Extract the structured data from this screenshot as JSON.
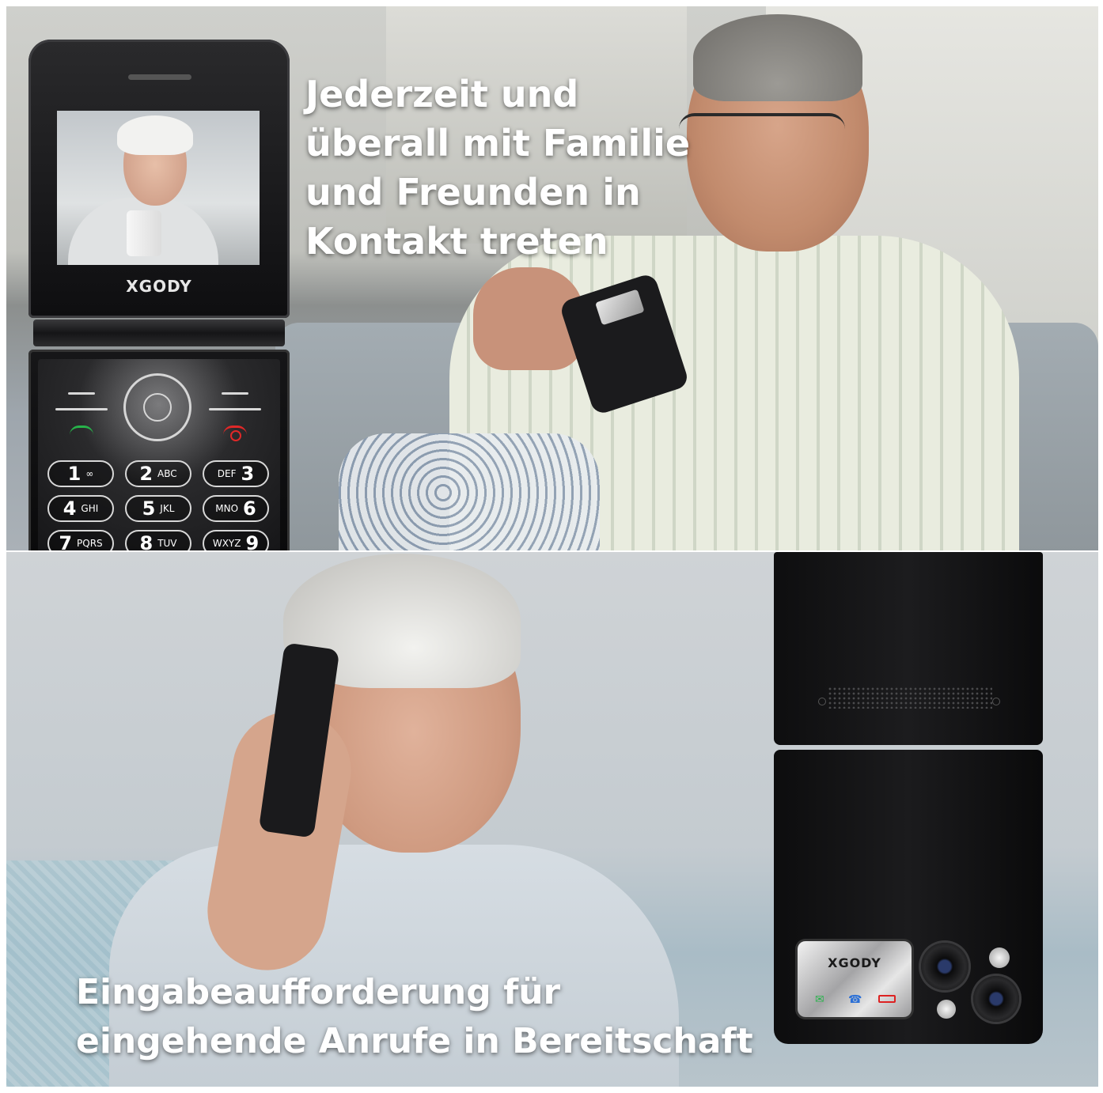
{
  "headlines": {
    "top": {
      "lines": [
        "Jederzeit und",
        "überall mit Familie",
        "und Freunden in",
        "Kontakt treten"
      ]
    },
    "bottom": {
      "lines": [
        "Eingabeaufforderung für",
        "eingehende Anrufe in Bereitschaft"
      ]
    }
  },
  "phone": {
    "brand": "XGODY",
    "keypad": [
      {
        "digit": "1",
        "letters": "∞"
      },
      {
        "digit": "2",
        "letters": "ABC"
      },
      {
        "digit": "3",
        "letters": "DEF"
      },
      {
        "digit": "4",
        "letters": "GHI"
      },
      {
        "digit": "5",
        "letters": "JKL"
      },
      {
        "digit": "6",
        "letters": "MNO"
      },
      {
        "digit": "7",
        "letters": "PQRS"
      },
      {
        "digit": "8",
        "letters": "TUV"
      },
      {
        "digit": "9",
        "letters": "WXYZ"
      }
    ]
  },
  "colors": {
    "headline_text": "#ffffff",
    "call_green": "#27b34a",
    "end_red": "#e02828",
    "phone_body": "#111112"
  },
  "icons": {
    "cover_message": "message-icon",
    "cover_call": "phone-icon",
    "cover_battery": "battery-icon"
  }
}
